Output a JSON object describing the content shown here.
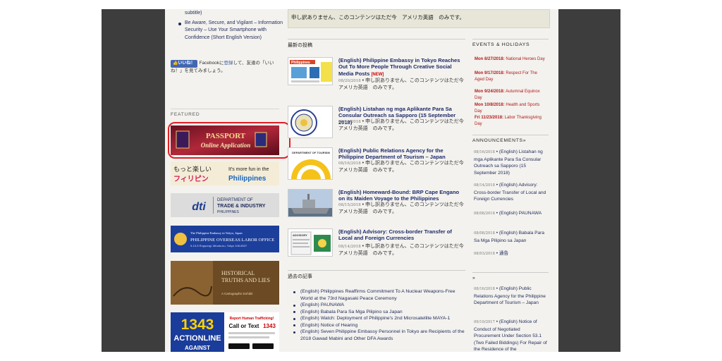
{
  "left": {
    "bullets": [
      {
        "text": "subtitle)",
        "dot": false
      },
      {
        "text": "Be Aware, Secure, and Vigilant – Information Security – Use Your Smartphone with Confidence (Short English Version)",
        "dot": true
      }
    ],
    "facebook": {
      "button": "いいね！",
      "prefix": "Facebookに",
      "link": "登録",
      "suffix": "して、友達の「いいね！」を見てみましょう。"
    },
    "featured_heading": "FEATURED",
    "banners": {
      "passport_line1": "PASSPORT",
      "passport_line2": "Online Application",
      "philippines_jp1": "もっと楽しい",
      "philippines_jp2": "フィリピン",
      "philippines_en1": "It's more fun in the",
      "philippines_en2": "Philippines",
      "dti_logo": "dti",
      "dti_line1": "DEPARTMENT OF",
      "dti_line2": "TRADE & INDUSTRY",
      "dti_line3": "PHILIPPINES",
      "polo_small": "The Philippine Embassy in Tokyo, Japan",
      "polo_big": "PHILIPPINE OVERSEAS LABOR OFFICE",
      "polo_addr": "5-15-5 Roppongi, Minato-ku, Tokyo 106-8537",
      "history_line1": "HISTORICAL",
      "history_line2": "TRUTHS AND LIES",
      "history_line3": "A Cartographic Exhibit",
      "hotline_num": "1343",
      "hotline_word": "ACTIONLINE",
      "hotline_sub": "AGAINST",
      "hotline_report": "Report Human Trafficking!",
      "hotline_call": "Call or Text",
      "hotline_call_num": "1343"
    }
  },
  "middle": {
    "notice": "申し訳ありません、このコンテンツはただ今　アメリカ英語　のみです。",
    "recent_heading": "最新の投稿",
    "posts": [
      {
        "title": "(English) Philippine Embassy in Tokyo Reaches Out To More People Through Creative Social Media Posts",
        "badge": "[NEW]",
        "date": "08/20/2018",
        "excerpt": "申し訳ありません、このコンテンツはただ今　アメリカ英語　のみです。"
      },
      {
        "title": "(English) Listahan ng mga Aplikante Para Sa Consular Outreach sa Sapporo (15 September 2018)",
        "badge": "",
        "date": "08/16/2018",
        "excerpt": "申し訳ありません、このコンテンツはただ今　アメリカ英語　のみです。"
      },
      {
        "title": "(English) Public Relations Agency for the Philippine Department of Tourism – Japan",
        "badge": "",
        "date": "08/16/2018",
        "excerpt": "申し訳ありません、このコンテンツはただ今　アメリカ英語　のみです。"
      },
      {
        "title": "(English) Homeward-Bound: BRP Cape Engano on its Maiden Voyage to the Philippines",
        "badge": "",
        "date": "08/15/2018",
        "excerpt": "申し訳ありません、このコンテンツはただ今　アメリカ英語　のみです。"
      },
      {
        "title": "(English) Advisory: Cross-border Transfer of Local and Foreign Currencies",
        "badge": "",
        "date": "08/14/2018",
        "excerpt": "申し訳ありません、このコンテンツはただ今　アメリカ英語　のみです。"
      }
    ],
    "thumb_labels": {
      "t1": "Philippines",
      "t3": "DEPARTMENT OF TOURISM",
      "t5": "ADVISORY"
    },
    "past_heading": "過去の記事",
    "past_items": [
      "(English) Philippines Reaffirms Commitment To A Nuclear Weapons-Free World at the 73rd Nagasaki Peace Ceremony",
      "(English) PAUNAWA",
      "(English) Babala Para Sa Mga Pilipino sa Japan",
      "(English) Watch: Deployment of Philippine's 2nd Microsatellite MAYA-1",
      "(English) Notice of Hearing",
      "(English) Seven Philippine Embassy Personnel in Tokyo are Recipients of the 2018 Gawad Mabini and Other DFA Awards"
    ]
  },
  "right": {
    "events_heading": "EVENTS & HOLIDAYS",
    "events": [
      {
        "date": "Mon 8/27/2018:",
        "name": "National Heroes Day"
      },
      {
        "date": "Mon 9/17/2018:",
        "name": "Respect For The Aged Day"
      },
      {
        "date": "Mon 9/24/2018:",
        "name": "Autumnal Equinox Day"
      },
      {
        "date": "Mon 10/8/2018:",
        "name": "Health and Sports Day"
      },
      {
        "date": "Fri 11/23/2018:",
        "name": "Labor Thanksgiving Day"
      }
    ],
    "announcements_heading": "ANNOUNCEMENTS»",
    "announcements": [
      {
        "date": "08/16/2018",
        "text": "(English) Listahan ng mga Aplikante Para Sa Consular Outreach sa Sapporo (15 September 2018)"
      },
      {
        "date": "08/14/2018",
        "text": "(English) Advisory: Cross-border Transfer of Local and Foreign Currencies"
      },
      {
        "date": "08/08/2018",
        "text": "(English) PAUNAWA"
      },
      {
        "date": "08/08/2018",
        "text": "(English) Babala Para Sa Mga Pilipino sa Japan"
      },
      {
        "date": "08/03/2018",
        "text": "通告"
      }
    ],
    "second_heading": "»",
    "second": [
      {
        "date": "08/16/2018",
        "text": "(English) Public Relations Agency for the Philippine Department of Tourism – Japan"
      },
      {
        "date": "09/19/2017",
        "text": "(English) Notice of Conduct of Negotiated Procurement Under Section 53.1 (Two Failed Biddings) For Repair of the Residence of the"
      }
    ]
  }
}
